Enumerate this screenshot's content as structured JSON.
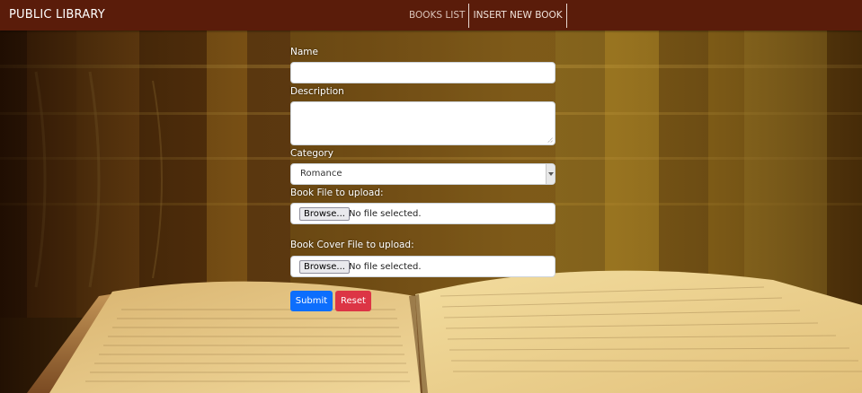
{
  "navbar": {
    "brand": "PUBLIC LIBRARY",
    "links": [
      {
        "label": "BOOKS LIST"
      },
      {
        "label": "INSERT NEW BOOK"
      }
    ],
    "background_color": "#5a1c0a"
  },
  "form": {
    "name_label": "Name",
    "name_value": "",
    "description_label": "Description",
    "description_value": "",
    "category_label": "Category",
    "category_value": "Romance",
    "book_file_label": "Book File to upload:",
    "book_file_button": "Browse...",
    "book_file_status": "No file selected.",
    "cover_file_label": "Book Cover File to upload:",
    "cover_file_button": "Browse...",
    "cover_file_status": "No file selected.",
    "submit_label": "Submit",
    "reset_label": "Reset"
  },
  "colors": {
    "submit": "#0d6efd",
    "reset": "#dc3545"
  }
}
